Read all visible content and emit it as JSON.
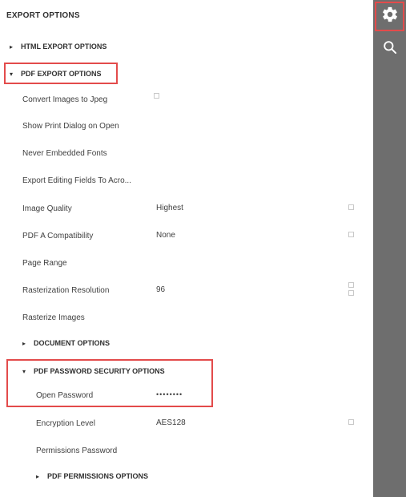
{
  "panel": {
    "title": "EXPORT OPTIONS",
    "sections": {
      "html_export": "HTML EXPORT OPTIONS",
      "pdf_export": "PDF EXPORT OPTIONS",
      "document": "DOCUMENT OPTIONS",
      "pdf_password_security": "PDF PASSWORD SECURITY OPTIONS",
      "pdf_permissions": "PDF PERMISSIONS OPTIONS"
    },
    "rows": {
      "convert_images": {
        "label": "Convert Images to Jpeg"
      },
      "show_print_dialog": {
        "label": "Show Print Dialog on Open"
      },
      "never_embedded_fonts": {
        "label": "Never Embedded Fonts"
      },
      "export_editing_fields": {
        "label": "Export Editing Fields To Acro..."
      },
      "image_quality": {
        "label": "Image Quality",
        "value": "Highest"
      },
      "pdf_a_compat": {
        "label": "PDF A Compatibility",
        "value": "None"
      },
      "page_range": {
        "label": "Page Range"
      },
      "rasterization_res": {
        "label": "Rasterization Resolution",
        "value": "96"
      },
      "rasterize_images": {
        "label": "Rasterize Images"
      },
      "open_password": {
        "label": "Open Password",
        "value": "••••••••"
      },
      "encryption_level": {
        "label": "Encryption Level",
        "value": "AES128"
      },
      "permissions_password": {
        "label": "Permissions Password"
      }
    }
  },
  "icons": {
    "triangle_right": "▸",
    "triangle_down": "▾",
    "gear": "gear-icon",
    "search": "search-icon"
  },
  "colors": {
    "highlight": "#e34b4b",
    "sidebar": "#6e6e6e",
    "sidebar_active": "#5a5a5a"
  }
}
